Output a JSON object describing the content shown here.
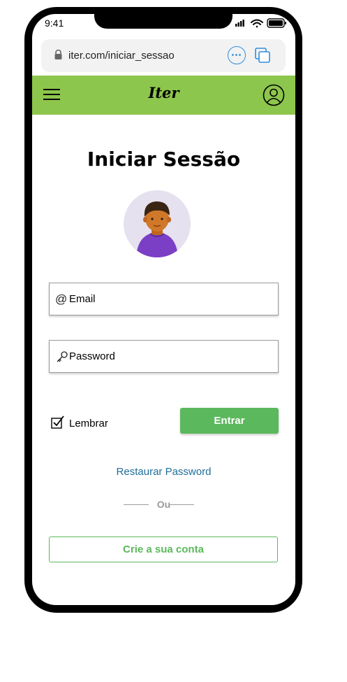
{
  "status": {
    "time": "9:41"
  },
  "browser": {
    "url": "iter.com/iniciar_sessao"
  },
  "appbar": {
    "brand": "Iter"
  },
  "page": {
    "title": "Iniciar Sessão"
  },
  "form": {
    "email_label": "Email",
    "email_icon": "@",
    "password_label": "Password",
    "remember_label": "Lembrar",
    "remember_checked": true,
    "enter_label": "Entrar",
    "restore_label": "Restaurar Password",
    "or_label": "Ou",
    "create_label": "Crie a sua conta"
  },
  "colors": {
    "appbar": "#8dc64c",
    "primary_button": "#5cb85c",
    "link": "#1f6e99",
    "browser_accent": "#2f8fe0"
  },
  "icons": [
    "lock-icon",
    "more-icon",
    "tabs-icon",
    "menu-icon",
    "profile-icon",
    "at-icon",
    "key-icon",
    "checkbox-icon",
    "signal-icon",
    "wifi-icon",
    "battery-icon"
  ]
}
